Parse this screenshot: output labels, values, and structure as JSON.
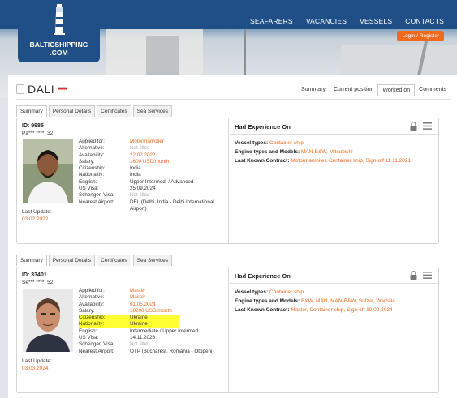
{
  "nav": {
    "brand_line1": "BALTICSHIPPING",
    "brand_line2": ".COM",
    "links": [
      "SEAFARERS",
      "VACANCIES",
      "VESSELS",
      "CONTACTS"
    ],
    "login": "Login",
    "register": "Register"
  },
  "vessel": {
    "name": "DALI",
    "tabs": [
      "Summary",
      "Current position",
      "Worked on",
      "Comments"
    ],
    "active_tab": "Worked on"
  },
  "card_tabs": [
    "Summary",
    "Personal Details",
    "Certificates",
    "Sea Services"
  ],
  "cards": [
    {
      "id": "ID: 9985",
      "sub": "Pa*** ****, 32",
      "last_update_label": "Last Update:",
      "last_update": "03.02.2022",
      "fields": [
        {
          "k": "Applied for:",
          "v": "Motorman/oiler"
        },
        {
          "k": "Alternative:",
          "v": "Not filled"
        },
        {
          "k": "Availability:",
          "v": "22.02.2022"
        },
        {
          "k": "Salary:",
          "v": "1600 USD/month"
        },
        {
          "k": "Citizenship:",
          "v": "India"
        },
        {
          "k": "Nationality:",
          "v": "India"
        },
        {
          "k": "English:",
          "v": "Upper Intermed. / Advanced"
        },
        {
          "k": "US Visa:",
          "v": "25.09.2024"
        },
        {
          "k": "Schengen Visa:",
          "v": "Not filled"
        },
        {
          "k": "Nearest Airport:",
          "v": "DEL (Delhi, India - Delhi International"
        },
        {
          "k": "",
          "v": "Airport)"
        }
      ],
      "exp_title": "Had Experience On",
      "vessel_types_label": "Vessel types:",
      "vessel_types": "Container ship",
      "engine_label": "Engine types and Models:",
      "engine": "MAN-B&W, Mitsubishi",
      "contract_label": "Last Known Contract:",
      "contract": "Motorman/oiler, Container ship, Sign-off 11.11.2021"
    },
    {
      "id": "ID: 33401",
      "sub": "Se*** ****, 52",
      "last_update_label": "Last Update:",
      "last_update": "03.03.2024",
      "fields": [
        {
          "k": "Applied for:",
          "v": "Master"
        },
        {
          "k": "Alternative:",
          "v": "Master"
        },
        {
          "k": "Availability:",
          "v": "01.05.2024"
        },
        {
          "k": "Salary:",
          "v": "10200 USD/month"
        },
        {
          "k": "Citizenship:",
          "v": "Ukraine"
        },
        {
          "k": "Nationality:",
          "v": "Ukraine"
        },
        {
          "k": "English:",
          "v": "Intermediate / Upper Intermed"
        },
        {
          "k": "US Visa:",
          "v": "14.11.2026"
        },
        {
          "k": "Schengen Visa:",
          "v": "Not filled"
        },
        {
          "k": "Nearest Airport:",
          "v": "OTP (Bucharest, Romania - Otopeni)"
        }
      ],
      "exp_title": "Had Experience On",
      "vessel_types_label": "Vessel types:",
      "vessel_types": "Container ship",
      "engine_label": "Engine types and Models:",
      "engine": "B&W, MAN, MAN-B&W, Sulzer, Wartsila",
      "contract_label": "Last Known Contract:",
      "contract": "Master, Container ship, Sign-off 19.02.2024"
    }
  ],
  "colors": {
    "accent": "#f06a1e",
    "nav": "#1f4f86",
    "highlight": "#ffff33"
  }
}
